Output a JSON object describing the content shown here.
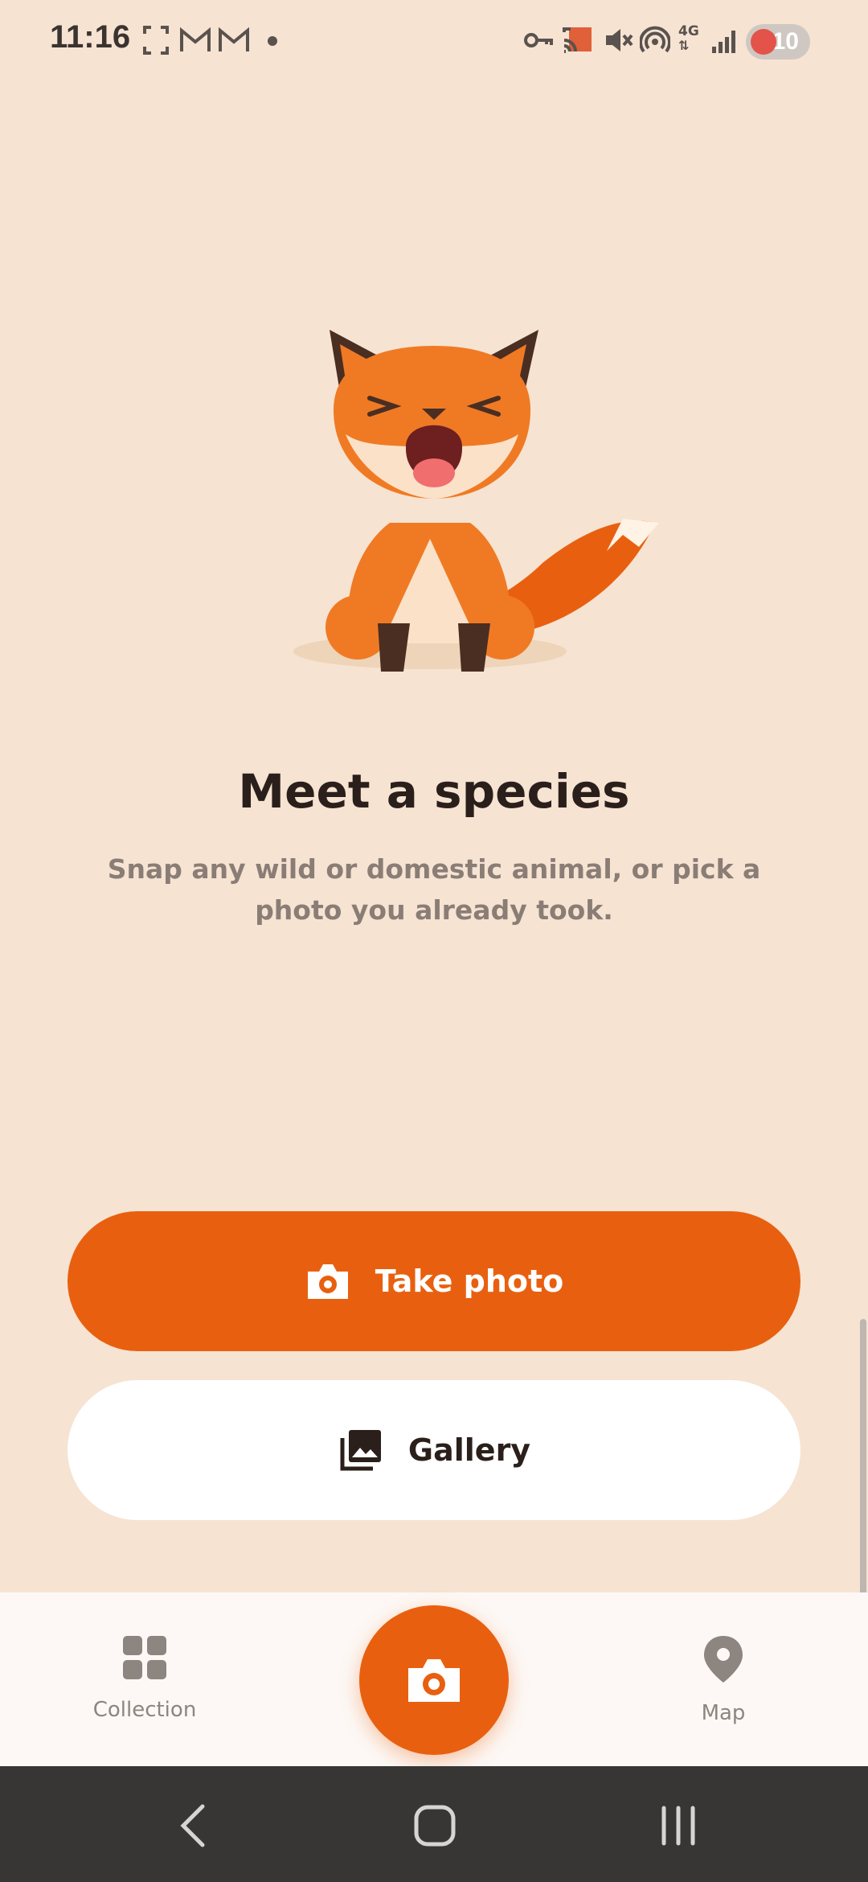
{
  "status_bar": {
    "time": "11:16",
    "icons": [
      "screenshot-icon",
      "gmail-icon",
      "gmail-icon",
      "dot-icon",
      "vpn-key-icon",
      "cast-icon",
      "mute-icon",
      "hotspot-icon",
      "4g-icon",
      "signal-icon"
    ],
    "network_label": "4G",
    "battery_level": "10"
  },
  "main": {
    "title": "Meet a species",
    "subtitle": "Snap any wild or domestic animal, or pick a photo you already took."
  },
  "actions": {
    "take_photo_label": "Take photo",
    "gallery_label": "Gallery"
  },
  "bottom_nav": {
    "collection_label": "Collection",
    "map_label": "Map"
  },
  "colors": {
    "background": "#f6e3d2",
    "accent": "#e8600f",
    "title": "#2a1f1b",
    "subtitle": "#8a7d76"
  }
}
